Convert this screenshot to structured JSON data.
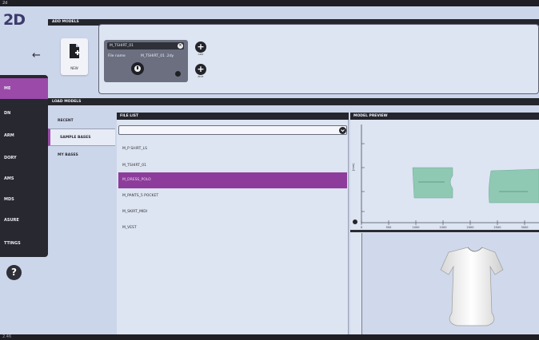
{
  "window": {
    "title": "2d"
  },
  "logo": "2D",
  "back_icon": "arrow-left-icon",
  "sidebar": {
    "items": [
      {
        "label": "ME",
        "active": true
      },
      {
        "label": "DN"
      },
      {
        "label": "ARM"
      },
      {
        "label": "DORY"
      },
      {
        "label": "AMS"
      },
      {
        "label": "MDS"
      },
      {
        "label": "ASURE"
      },
      {
        "label": "TTINGS"
      }
    ],
    "help_label": "?"
  },
  "add_models": {
    "header": "ADD MODELS",
    "new_button_label": "NEW",
    "card": {
      "name": "M_TSHIRT_01",
      "file_label": "File name",
      "file_value": "M_TSHIRT_01 .2dy"
    },
    "plus_top_label": "+",
    "plus_bottom_label": "+",
    "plus_top_caption": "ADD",
    "plus_bottom_caption": "EDIT"
  },
  "load_models": {
    "header": "LOAD MODELS",
    "tabs": [
      {
        "label": "RECENT"
      },
      {
        "label": "SAMPLE BASES",
        "active": true
      },
      {
        "label": "MY BASES"
      }
    ]
  },
  "file_list": {
    "header": "FILE LIST",
    "search_value": "",
    "items": [
      {
        "label": "M_P SHIRT_LS"
      },
      {
        "label": "M_TSHIRT_01"
      },
      {
        "label": "M_DRESS_POLO",
        "selected": true
      },
      {
        "label": "M_PANTS_5 POCKET"
      },
      {
        "label": "M_SKIRT_MIDI"
      },
      {
        "label": "M_VEST"
      }
    ]
  },
  "model_preview": {
    "header": "MODEL PREVIEW",
    "ruler_x_ticks": [
      "0",
      "500",
      "1000",
      "1500",
      "2000",
      "2500",
      "3000"
    ],
    "ruler_x_unit": "[mm]",
    "ruler_y_label": "[mm]",
    "ruler_y_ticks": [
      "0",
      "250",
      "500",
      "750"
    ],
    "pattern_color": "#8fc9b3",
    "garment_color": "#f4f4f4"
  },
  "colors": {
    "accent": "#9b4aa9",
    "dark_bar": "#25262d",
    "panel_bg": "#ccd6ea"
  },
  "status_bar": "2.46"
}
